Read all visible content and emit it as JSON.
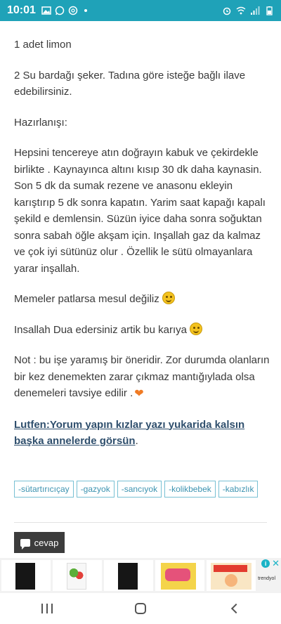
{
  "status_bar": {
    "time": "10:01",
    "left_icons": [
      "image-icon",
      "whatsapp-icon",
      "at-icon"
    ],
    "right_icons": [
      "alarm-icon",
      "wifi-icon",
      "signal-icon",
      "battery-icon"
    ],
    "color": "#1fa2b8"
  },
  "post": {
    "line_lemon": "1 adet limon",
    "line_sugar": "2 Su bardağı şeker.  Tadına göre isteğe bağlı ilave edebilirsiniz.",
    "heading_preparation": "Hazırlanışı:",
    "instructions": "Hepsini tencereye atın doğrayın kabuk ve çekirdekle birlikte . Kaynayınca altını kısıp 30 dk daha kaynasin. Son 5 dk da sumak rezene ve anasonu ekleyin karıştırıp 5 dk sonra kapatın. Yarim saat kapağı kapalı şekild e demlensin.  Süzün iyice daha sonra soğuktan sonra sabah öğle akşam için.  Inşallah gaz da kalmaz ve çok iyi sütünüz olur . Özellik le sütü olmayanlara yarar inşallah.",
    "line_memeler": "Memeler patlarsa mesul değiliz",
    "line_dua": "Insallah Dua edersiniz artik bu karıya",
    "note": "Not : bu işe yaramış bir öneridir.  Zor durumda olanların bir kez denemekten zarar çıkmaz mantığıylada olsa denemeleri tavsiye edilir .",
    "link_text": "Lutfen:Yorum yapın kızlar yazı yukarida kalsın başka annelerde görsün",
    "link_suffix": "."
  },
  "tags": [
    "-sütartırıcıçay",
    "-gazyok",
    "-sancıyok",
    "-kolikbebek",
    "-kabızlık"
  ],
  "reply_button": {
    "label": "cevap"
  },
  "ad": {
    "brand": "trendyol",
    "items": [
      "book-cover-dark",
      "book-cover-fruits",
      "book-cover-black",
      "book-cover-kids",
      "book-cover-yuk-tarifi"
    ]
  },
  "navbar": {
    "buttons": [
      "recents-icon",
      "home-icon",
      "back-icon"
    ]
  }
}
